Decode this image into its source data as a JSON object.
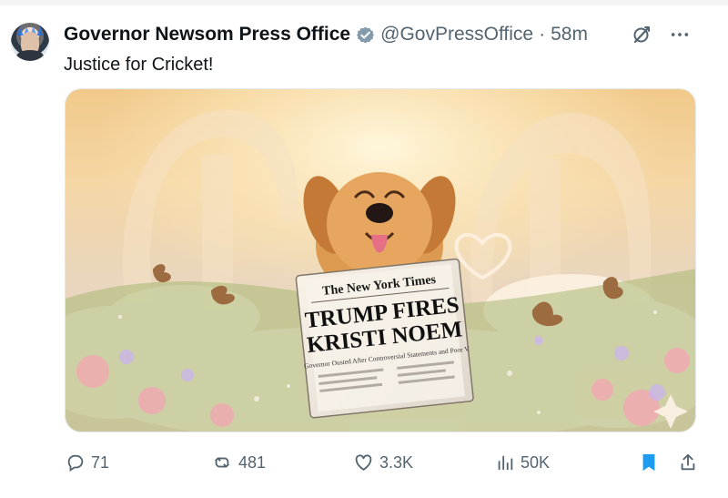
{
  "post": {
    "display_name": "Governor Newsom Press Office",
    "handle": "@GovPressOffice",
    "separator": "·",
    "time": "58m",
    "text": "Justice for Cricket!"
  },
  "media": {
    "newspaper": {
      "masthead": "The New York Times",
      "headline_line1": "TRUMP FIRES",
      "headline_line2": "KRISTI NOEM",
      "subhead": "Governor Ousted After Controversial Statements and Poor V"
    }
  },
  "actions": {
    "replies": "71",
    "reposts": "481",
    "likes": "3.3K",
    "views": "50K"
  },
  "colors": {
    "text": "#0f1419",
    "secondary": "#536471",
    "blue": "#1d9bf0",
    "bookmark": "#1d9bf0"
  },
  "icons": {
    "verified": "verified-icon",
    "grok": "grok-icon",
    "more": "more-icon",
    "reply": "reply-icon",
    "repost": "repost-icon",
    "like": "like-icon",
    "views": "views-icon",
    "bookmark": "bookmark-icon",
    "share": "share-icon"
  }
}
